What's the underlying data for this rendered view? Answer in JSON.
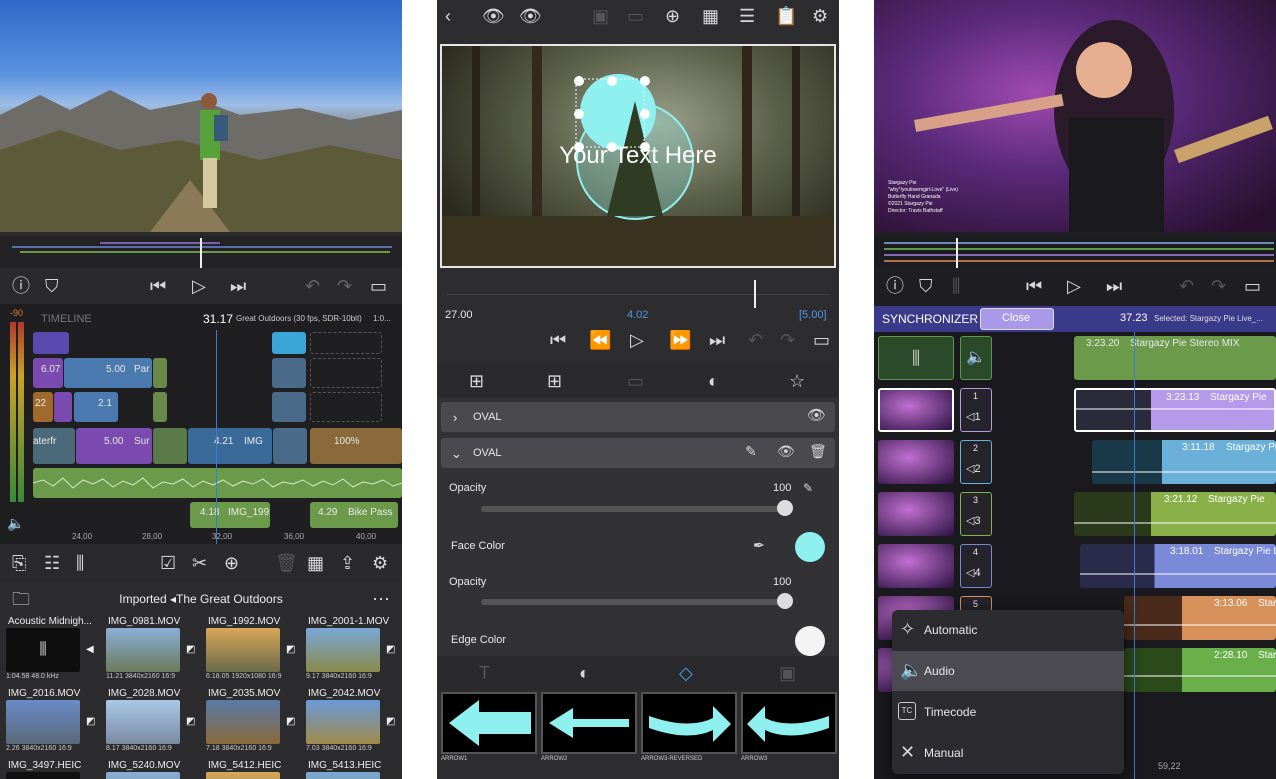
{
  "panel1": {
    "timeline_label": "TIMELINE",
    "timecode": "31.17",
    "project_info": "Great Outdoors (30 fps, SDR-10bit)",
    "project_extra": "1:0...",
    "meter_top": "-90",
    "clips": [
      {
        "label": "6.07"
      },
      {
        "label": "5.00",
        "name": "Par"
      },
      {
        "label": "22"
      },
      {
        "label": "2.1"
      },
      {
        "label": "5.00",
        "name": "Sur"
      },
      {
        "label": "4.21",
        "name": "IMG"
      },
      {
        "label": "100%"
      },
      {
        "label": "aterfr"
      }
    ],
    "audio_clips": [
      {
        "time": "4.18",
        "name": "IMG_199"
      },
      {
        "time": "4.29",
        "name": "Bike Pass"
      }
    ],
    "ruler": [
      "24,00",
      "28,00",
      "32,00",
      "36,00",
      "40,00"
    ],
    "browser_title": "Imported ◂The Great Outdoors",
    "media": [
      {
        "name": "Acoustic Midnigh...",
        "info": "1:04.58  48.0 kHz"
      },
      {
        "name": "IMG_0981.MOV",
        "info": "11.21  3840x2160  16:9"
      },
      {
        "name": "IMG_1992.MOV",
        "info": "6:18.05  1920x1080  16:9"
      },
      {
        "name": "IMG_2001-1.MOV",
        "info": "9.17  3840x2160  16:9"
      },
      {
        "name": "IMG_2016.MOV",
        "info": "2.26  3840x2160  16:9"
      },
      {
        "name": "IMG_2028.MOV",
        "info": "8.17  3840x2160  16:9"
      },
      {
        "name": "IMG_2035.MOV",
        "info": "7.18  3840x2160  16:9"
      },
      {
        "name": "IMG_2042.MOV",
        "info": "7.03  3840x2160  16:9"
      },
      {
        "name": "IMG_3497.HEIC",
        "info": ""
      },
      {
        "name": "IMG_5240.MOV",
        "info": ""
      },
      {
        "name": "IMG_5412.HEIC",
        "info": ""
      },
      {
        "name": "IMG_5413.HEIC",
        "info": ""
      }
    ]
  },
  "panel2": {
    "overlay_text": "Your Text Here",
    "time_left": "27.00",
    "time_mid": "4.02",
    "time_right": "[5.00]",
    "section1": "OVAL",
    "section2": "OVAL",
    "opacity_label": "Opacity",
    "opacity_value": "100",
    "face_color_label": "Face Color",
    "opacity2_label": "Opacity",
    "opacity2_value": "100",
    "edge_color_label": "Edge Color",
    "shapes": [
      "ARROW1",
      "ARROW2",
      "ARROW3-REVERSED",
      "ARROW3"
    ],
    "accent": "#8ff0f0"
  },
  "panel3": {
    "overlay_credits": [
      "Stargazy Pie",
      "\"why\"/youlovemgirl-Love\" (Live)",
      "Butterfly Hand Granada",
      "©2021 Stargazy Pie",
      "Director: Travis Bathstaff"
    ],
    "synchronizer_label": "SYNCHRONIZER",
    "close_button": "Close",
    "sync_time": "37.23",
    "sync_selected": "Selected: Stargazy Pie Live_...",
    "master_clip": {
      "time": "3:23.20",
      "name": "Stargazy Pie Stereo MIX"
    },
    "tracks": [
      {
        "num": "1",
        "sub": "◁1",
        "time": "3:23.13",
        "name": "Stargazy Pie"
      },
      {
        "num": "2",
        "sub": "◁2",
        "time": "3:11.18",
        "name": "Stargazy Pie"
      },
      {
        "num": "3",
        "sub": "◁3",
        "time": "3:21.12",
        "name": "Stargazy Pie"
      },
      {
        "num": "4",
        "sub": "◁4",
        "time": "3:18.01",
        "name": "Stargazy Pie L"
      },
      {
        "num": "5",
        "sub": "",
        "time": "3:13.06",
        "name": "Stargazy Pie"
      },
      {
        "num": "",
        "sub": "",
        "time": "2:28.10",
        "name": "Stargazy Pie L"
      }
    ],
    "menu": [
      "Automatic",
      "Audio",
      "Timecode",
      "Manual"
    ],
    "ruler_value": "59,22"
  }
}
